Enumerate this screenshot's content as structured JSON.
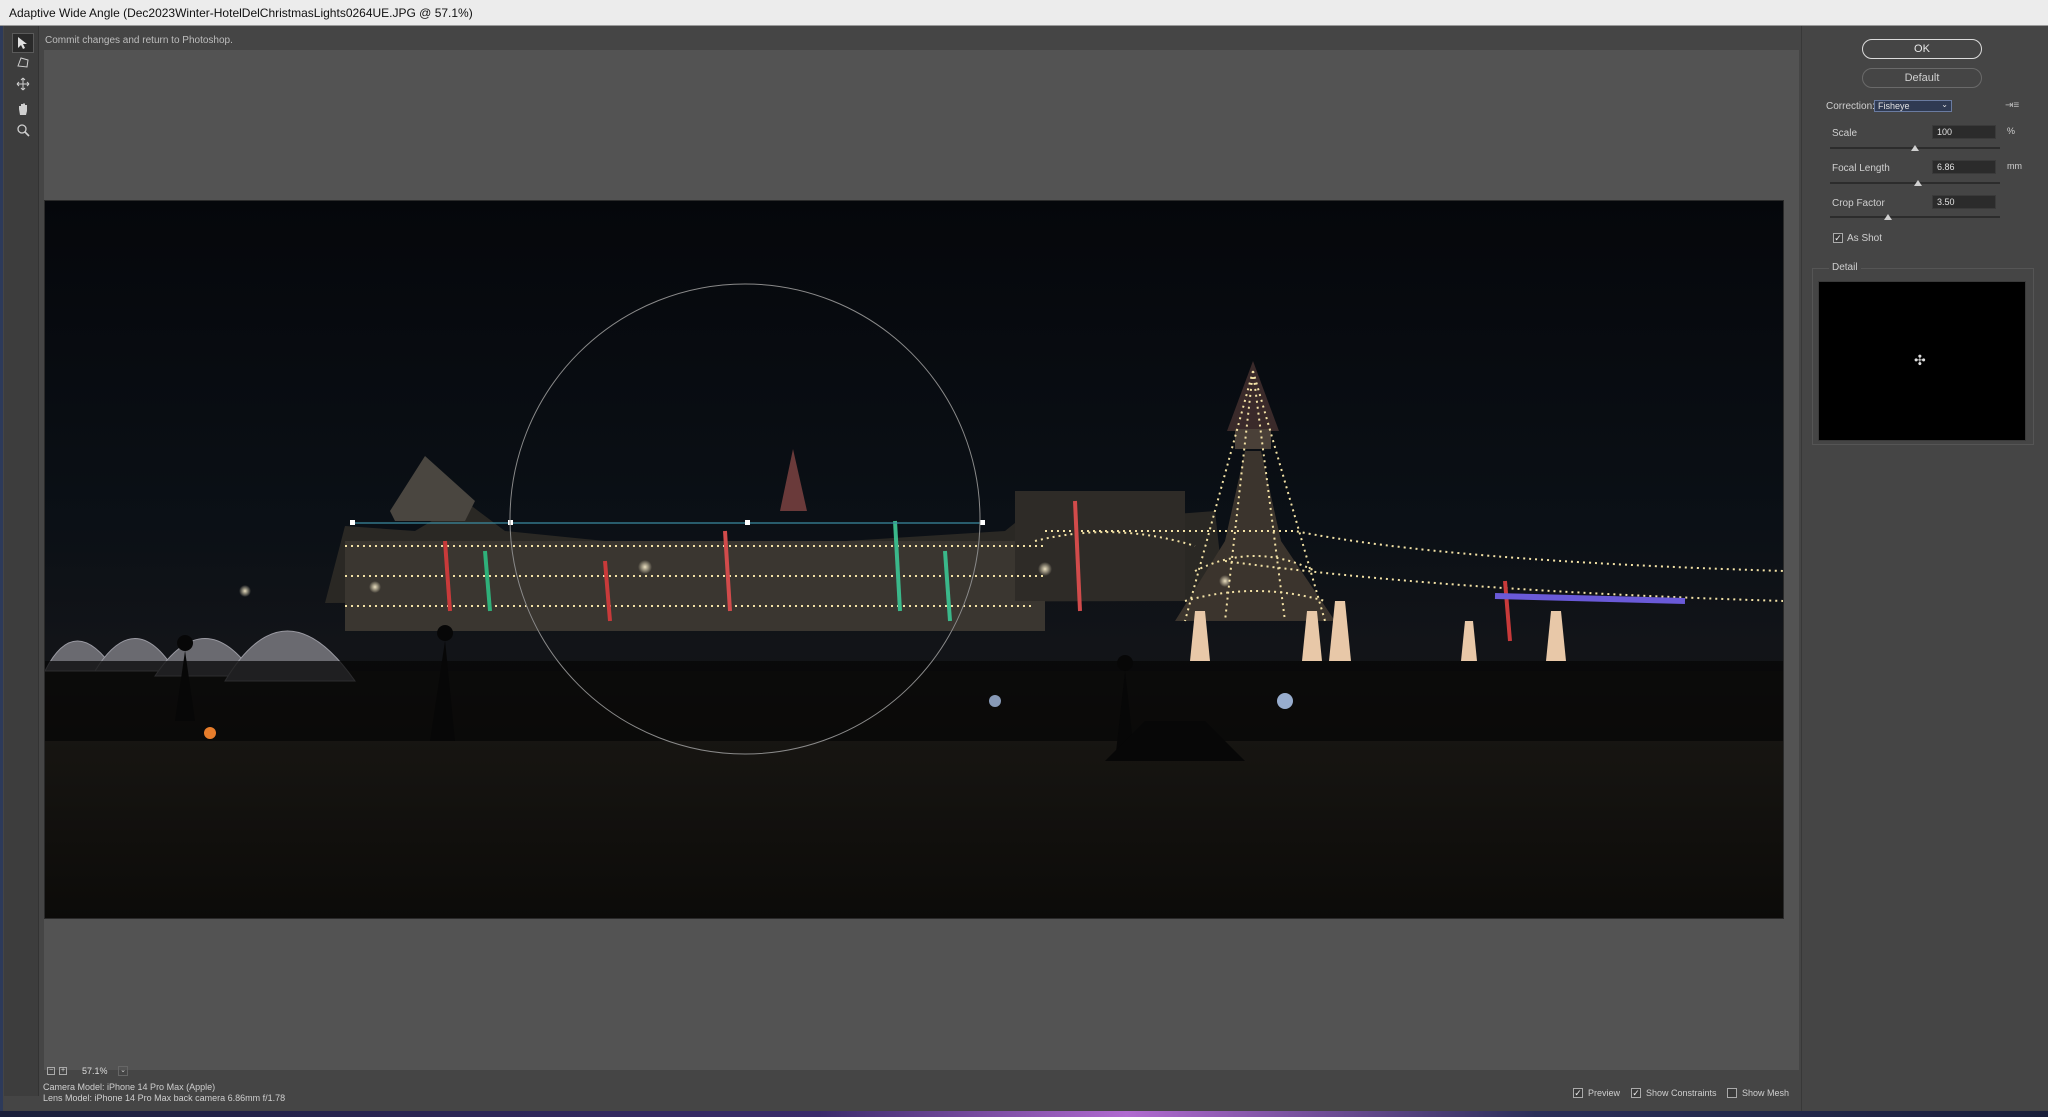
{
  "window": {
    "title": "Adaptive Wide Angle (Dec2023Winter-HotelDelChristmasLights0264UE.JPG @ 57.1%)"
  },
  "toolbar": {
    "tools": [
      {
        "name": "constraint-tool-icon",
        "glyph": "↖"
      },
      {
        "name": "polygon-constraint-tool-icon",
        "glyph": "⬠"
      },
      {
        "name": "move-tool-icon",
        "glyph": "✥"
      },
      {
        "name": "hand-tool-icon",
        "glyph": "✋"
      },
      {
        "name": "zoom-tool-icon",
        "glyph": "🔍"
      }
    ]
  },
  "hint": "Commit changes and return to Photoshop.",
  "buttons": {
    "ok": "OK",
    "default": "Default"
  },
  "correction": {
    "label": "Correction:",
    "selected": "Fisheye"
  },
  "params": {
    "scale": {
      "label": "Scale",
      "value": "100",
      "unit": "%",
      "level": 0.5
    },
    "focal_length": {
      "label": "Focal Length",
      "value": "6.86",
      "unit": "mm",
      "level": 0.52
    },
    "crop_factor": {
      "label": "Crop Factor",
      "value": "3.50",
      "unit": "",
      "level": 0.34
    }
  },
  "as_shot": {
    "label": "As Shot",
    "checked": true
  },
  "detail": {
    "label": "Detail"
  },
  "zoom": {
    "value": "57.1%"
  },
  "meta": {
    "camera": "Camera Model: iPhone 14 Pro Max (Apple)",
    "lens": "Lens Model: iPhone 14 Pro Max back camera 6.86mm f/1.78"
  },
  "options": {
    "preview": {
      "label": "Preview",
      "checked": true
    },
    "constraints": {
      "label": "Show Constraints",
      "checked": true
    },
    "mesh": {
      "label": "Show Mesh",
      "checked": false
    }
  }
}
